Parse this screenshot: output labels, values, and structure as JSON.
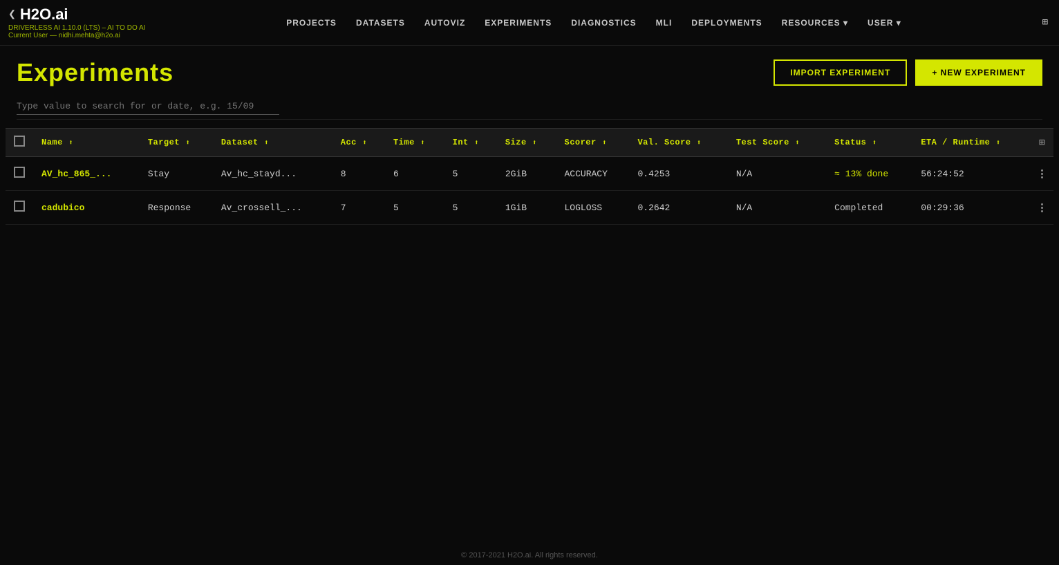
{
  "brand": {
    "arrow": "❮",
    "name": "H2O.ai",
    "subtitle": "DRIVERLESS AI 1.10.0 (LTS) – AI TO DO AI",
    "user_label": "Current User —",
    "user_email": "nidhi.mehta@h2o.ai"
  },
  "nav": {
    "links": [
      {
        "label": "PROJECTS",
        "id": "projects"
      },
      {
        "label": "DATASETS",
        "id": "datasets"
      },
      {
        "label": "AUTOVIZ",
        "id": "autoviz"
      },
      {
        "label": "EXPERIMENTS",
        "id": "experiments"
      },
      {
        "label": "DIAGNOSTICS",
        "id": "diagnostics"
      },
      {
        "label": "MLI",
        "id": "mli"
      },
      {
        "label": "DEPLOYMENTS",
        "id": "deployments"
      },
      {
        "label": "RESOURCES ▾",
        "id": "resources"
      },
      {
        "label": "USER ▾",
        "id": "user"
      }
    ]
  },
  "page": {
    "title": "Experiments",
    "import_label": "IMPORT EXPERIMENT",
    "new_label": "+ NEW EXPERIMENT",
    "search_placeholder": "Type value to search for or date, e.g. 15/09"
  },
  "table": {
    "columns": [
      {
        "label": "Name",
        "id": "name"
      },
      {
        "label": "Target",
        "id": "target"
      },
      {
        "label": "Dataset",
        "id": "dataset"
      },
      {
        "label": "Acc",
        "id": "acc"
      },
      {
        "label": "Time",
        "id": "time"
      },
      {
        "label": "Int",
        "id": "int"
      },
      {
        "label": "Size",
        "id": "size"
      },
      {
        "label": "Scorer",
        "id": "scorer"
      },
      {
        "label": "Val. Score",
        "id": "val_score"
      },
      {
        "label": "Test Score",
        "id": "test_score"
      },
      {
        "label": "Status",
        "id": "status"
      },
      {
        "label": "ETA / Runtime",
        "id": "eta_runtime"
      }
    ],
    "rows": [
      {
        "name": "AV_hc_865_...",
        "target": "Stay",
        "dataset": "Av_hc_stayd...",
        "acc": "8",
        "time": "6",
        "int": "5",
        "size": "2GiB",
        "scorer": "ACCURACY",
        "val_score": "0.4253",
        "test_score": "N/A",
        "status": "≈ 13% done",
        "status_type": "inprogress",
        "eta_runtime": "56:24:52"
      },
      {
        "name": "cadubico",
        "target": "Response",
        "dataset": "Av_crossell_...",
        "acc": "7",
        "time": "5",
        "int": "5",
        "size": "1GiB",
        "scorer": "LOGLOSS",
        "val_score": "0.2642",
        "test_score": "N/A",
        "status": "Completed",
        "status_type": "completed",
        "eta_runtime": "00:29:36"
      }
    ]
  },
  "footer": {
    "text": "© 2017-2021 H2O.ai. All rights reserved."
  }
}
